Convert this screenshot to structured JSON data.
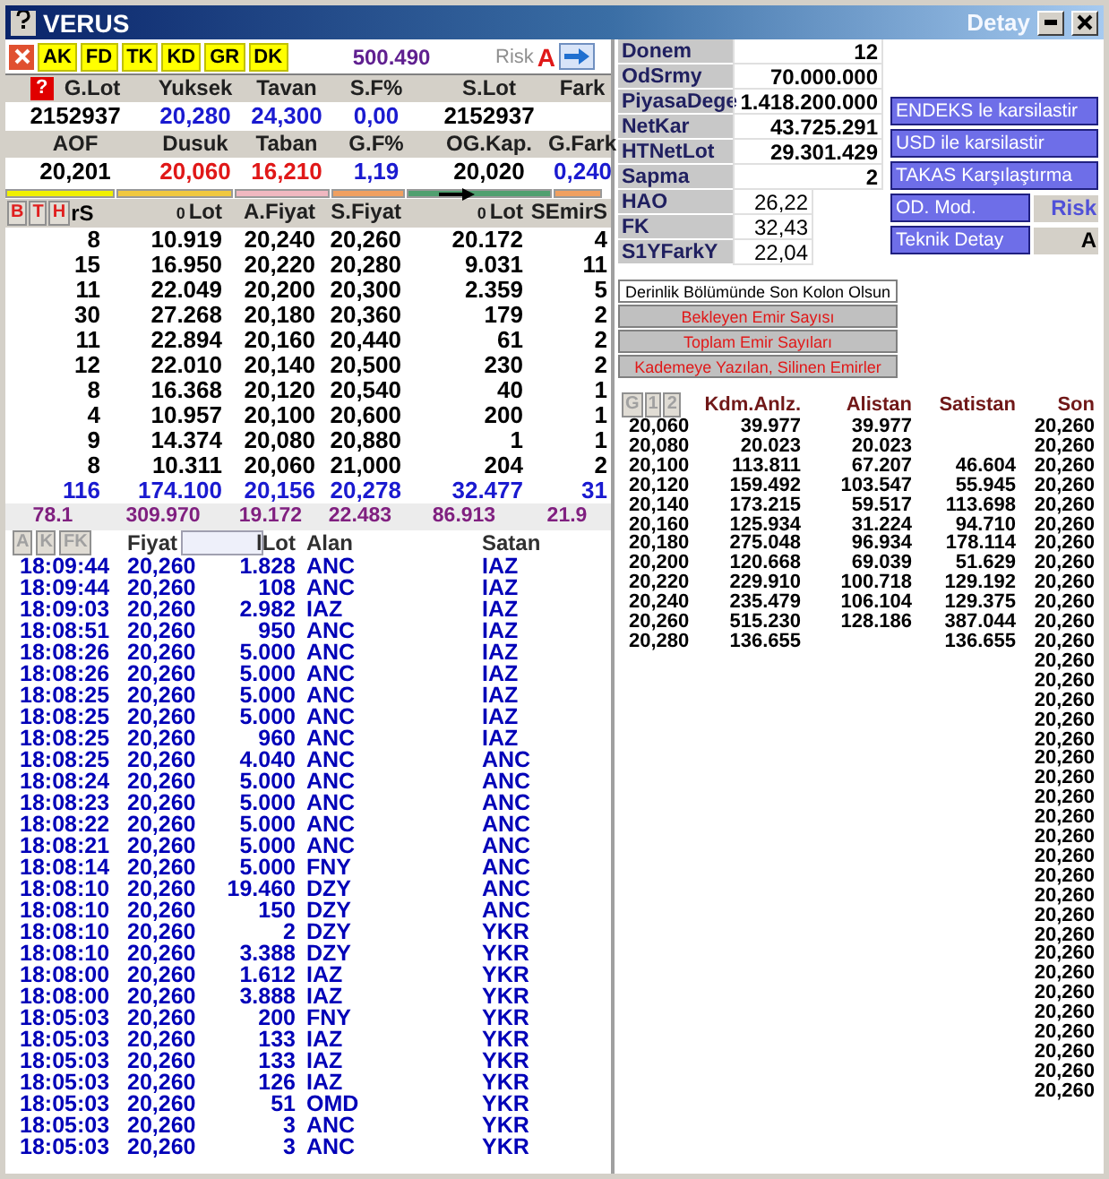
{
  "window": {
    "title": "VERUS",
    "side_title": "Detay"
  },
  "toolbar": {
    "tags": [
      "AK",
      "FD",
      "TK",
      "KD",
      "GR",
      "DK"
    ],
    "value": "500.490",
    "risk_label": "Risk",
    "risk_grade": "A"
  },
  "summary": [
    {
      "labels": [
        "G.Lot",
        "Yuksek",
        "Tavan",
        "S.F%",
        "S.Lot",
        "Fark"
      ],
      "values": [
        {
          "text": "2152937",
          "color": "#000000"
        },
        {
          "text": "20,280",
          "color": "#1a1ad0"
        },
        {
          "text": "24,300",
          "color": "#1a1ad0"
        },
        {
          "text": "0,00",
          "color": "#1a1ad0"
        },
        {
          "text": "2152937",
          "color": "#000000"
        }
      ]
    },
    {
      "labels": [
        "AOF",
        "Dusuk",
        "Taban",
        "G.F%",
        "OG.Kap.",
        "G.Fark"
      ],
      "values": [
        {
          "text": "20,201",
          "color": "#000000"
        },
        {
          "text": "20,060",
          "color": "#e01818"
        },
        {
          "text": "16,210",
          "color": "#e01818"
        },
        {
          "text": "1,19",
          "color": "#1a1ad0"
        },
        {
          "text": "20,020",
          "color": "#000000"
        },
        {
          "text": "0,240",
          "color": "#1a1ad0"
        }
      ]
    }
  ],
  "depth": {
    "buttons": [
      "B",
      "T",
      "H"
    ],
    "columns": [
      {
        "label": "rS"
      },
      {
        "prefix": "0",
        "label": "Lot"
      },
      {
        "label": "A.Fiyat"
      },
      {
        "label": "S.Fiyat"
      },
      {
        "prefix": "0",
        "label": "Lot"
      },
      {
        "label": "SEmirS"
      }
    ],
    "rows": [
      [
        "8",
        "10.919",
        "20,240",
        "20,260",
        "20.172",
        "4"
      ],
      [
        "15",
        "16.950",
        "20,220",
        "20,280",
        "9.031",
        "11"
      ],
      [
        "11",
        "22.049",
        "20,200",
        "20,300",
        "2.359",
        "5"
      ],
      [
        "30",
        "27.268",
        "20,180",
        "20,360",
        "179",
        "2"
      ],
      [
        "11",
        "22.894",
        "20,160",
        "20,440",
        "61",
        "2"
      ],
      [
        "12",
        "22.010",
        "20,140",
        "20,500",
        "230",
        "2"
      ],
      [
        "8",
        "16.368",
        "20,120",
        "20,540",
        "40",
        "1"
      ],
      [
        "4",
        "10.957",
        "20,100",
        "20,600",
        "200",
        "1"
      ],
      [
        "9",
        "14.374",
        "20,080",
        "20,880",
        "1",
        "1"
      ],
      [
        "8",
        "10.311",
        "20,060",
        "21,000",
        "204",
        "2"
      ]
    ],
    "totals": [
      "116",
      "174.100",
      "20,156",
      "20,278",
      "32.477",
      "31"
    ],
    "averages": [
      "78.1",
      "309.970",
      "19.172",
      "22.483",
      "86.913",
      "21.9"
    ]
  },
  "summary_help": "?",
  "trades": {
    "columns": [
      {
        "kind": "buttons",
        "buttons": [
          "A",
          "K",
          "FK"
        ]
      },
      {
        "kind": "filter",
        "label": "Fiyat"
      },
      {
        "kind": "plain",
        "label": "lLot"
      },
      {
        "kind": "plain",
        "label": "Alan"
      },
      {
        "kind": "plain",
        "label": "Satan"
      }
    ],
    "rows": [
      [
        "18:09:44",
        "20,260",
        "1.828",
        "ANC",
        "IAZ"
      ],
      [
        "18:09:44",
        "20,260",
        "108",
        "ANC",
        "IAZ"
      ],
      [
        "18:09:03",
        "20,260",
        "2.982",
        "IAZ",
        "IAZ"
      ],
      [
        "18:08:51",
        "20,260",
        "950",
        "ANC",
        "IAZ"
      ],
      [
        "18:08:26",
        "20,260",
        "5.000",
        "ANC",
        "IAZ"
      ],
      [
        "18:08:26",
        "20,260",
        "5.000",
        "ANC",
        "IAZ"
      ],
      [
        "18:08:25",
        "20,260",
        "5.000",
        "ANC",
        "IAZ"
      ],
      [
        "18:08:25",
        "20,260",
        "5.000",
        "ANC",
        "IAZ"
      ],
      [
        "18:08:25",
        "20,260",
        "960",
        "ANC",
        "IAZ"
      ],
      [
        "18:08:25",
        "20,260",
        "4.040",
        "ANC",
        "ANC"
      ],
      [
        "18:08:24",
        "20,260",
        "5.000",
        "ANC",
        "ANC"
      ],
      [
        "18:08:23",
        "20,260",
        "5.000",
        "ANC",
        "ANC"
      ],
      [
        "18:08:22",
        "20,260",
        "5.000",
        "ANC",
        "ANC"
      ],
      [
        "18:08:21",
        "20,260",
        "5.000",
        "ANC",
        "ANC"
      ],
      [
        "18:08:14",
        "20,260",
        "5.000",
        "FNY",
        "ANC"
      ],
      [
        "18:08:10",
        "20,260",
        "19.460",
        "DZY",
        "ANC"
      ],
      [
        "18:08:10",
        "20,260",
        "150",
        "DZY",
        "ANC"
      ],
      [
        "18:08:10",
        "20,260",
        "2",
        "DZY",
        "YKR"
      ],
      [
        "18:08:10",
        "20,260",
        "3.388",
        "DZY",
        "YKR"
      ],
      [
        "18:08:00",
        "20,260",
        "1.612",
        "IAZ",
        "YKR"
      ],
      [
        "18:08:00",
        "20,260",
        "3.888",
        "IAZ",
        "YKR"
      ],
      [
        "18:05:03",
        "20,260",
        "200",
        "FNY",
        "YKR"
      ],
      [
        "18:05:03",
        "20,260",
        "133",
        "IAZ",
        "YKR"
      ],
      [
        "18:05:03",
        "20,260",
        "133",
        "IAZ",
        "YKR"
      ],
      [
        "18:05:03",
        "20,260",
        "126",
        "IAZ",
        "YKR"
      ],
      [
        "18:05:03",
        "20,260",
        "51",
        "OMD",
        "YKR"
      ],
      [
        "18:05:03",
        "20,260",
        "3",
        "ANC",
        "YKR"
      ],
      [
        "18:05:03",
        "20,260",
        "3",
        "ANC",
        "YKR"
      ]
    ]
  },
  "info": [
    {
      "label": "Donem",
      "value": "12",
      "kind": "wide"
    },
    {
      "label": "OdSrmy",
      "value": "70.000.000",
      "kind": "wide"
    },
    {
      "label": "PiyasaDege",
      "value": "1.418.200.000",
      "kind": "wide"
    },
    {
      "label": "NetKar",
      "value": "43.725.291",
      "kind": "wide"
    },
    {
      "label": "HTNetLot",
      "value": "29.301.429",
      "kind": "wide"
    },
    {
      "label": "Sapma",
      "value": "2",
      "kind": "wide"
    },
    {
      "label": "HAO",
      "value": "26,22",
      "kind": "narrow"
    },
    {
      "label": "FK",
      "value": "32,43",
      "kind": "narrow"
    },
    {
      "label": "S1YFarkY",
      "value": "22,04",
      "kind": "narrow"
    }
  ],
  "compare_buttons": [
    "ENDEKS le karsilastir",
    "USD ile karsilastir",
    "TAKAS Karşılaştırma"
  ],
  "mode_rows": [
    {
      "button": "OD. Mod.",
      "note": "Risk",
      "color": "#5050d8"
    },
    {
      "button": "Teknik Detay",
      "note": "A",
      "color": "#000000"
    }
  ],
  "order_buttons": [
    {
      "label": "Derinlik Bölümünde Son Kolon Olsun",
      "kind": "plain"
    },
    {
      "label": "Bekleyen Emir Sayısı",
      "kind": "alert"
    },
    {
      "label": "Toplam Emir Sayıları",
      "kind": "alert"
    },
    {
      "label": "Kademeye Yazılan, Silinen Emirler",
      "kind": "alert"
    }
  ],
  "levels": {
    "columns": [
      {
        "kind": "buttons",
        "buttons": [
          "G",
          "1",
          "2"
        ]
      },
      {
        "kind": "plain",
        "label": "Kdm.Anlz."
      },
      {
        "kind": "plain",
        "label": "Alistan"
      },
      {
        "kind": "plain",
        "label": "Satistan"
      },
      {
        "kind": "plain",
        "label": "Son"
      }
    ],
    "rows": [
      [
        "20,060",
        "39.977",
        "39.977",
        "",
        "20,260"
      ],
      [
        "20,080",
        "20.023",
        "20.023",
        "",
        "20,260"
      ],
      [
        "20,100",
        "113.811",
        "67.207",
        "46.604",
        "20,260"
      ],
      [
        "20,120",
        "159.492",
        "103.547",
        "55.945",
        "20,260"
      ],
      [
        "20,140",
        "173.215",
        "59.517",
        "113.698",
        "20,260"
      ],
      [
        "20,160",
        "125.934",
        "31.224",
        "94.710",
        "20,260"
      ],
      [
        "20,180",
        "275.048",
        "96.934",
        "178.114",
        "20,260"
      ],
      [
        "20,200",
        "120.668",
        "69.039",
        "51.629",
        "20,260"
      ],
      [
        "20,220",
        "229.910",
        "100.718",
        "129.192",
        "20,260"
      ],
      [
        "20,240",
        "235.479",
        "106.104",
        "129.375",
        "20,260"
      ],
      [
        "20,260",
        "515.230",
        "128.186",
        "387.044",
        "20,260"
      ],
      [
        "20,280",
        "136.655",
        "",
        "136.655",
        "20,260"
      ]
    ],
    "son_continued": [
      "20,260",
      "20,260",
      "20,260",
      "20,260",
      "20,260",
      "20,260",
      "20,260",
      "20,260",
      "20,260",
      "20,260",
      "20,260",
      "20,260",
      "20,260",
      "20,260",
      "20,260",
      "20,260",
      "20,260",
      "20,260",
      "20,260",
      "20,260",
      "20,260",
      "20,260",
      "20,260"
    ]
  }
}
